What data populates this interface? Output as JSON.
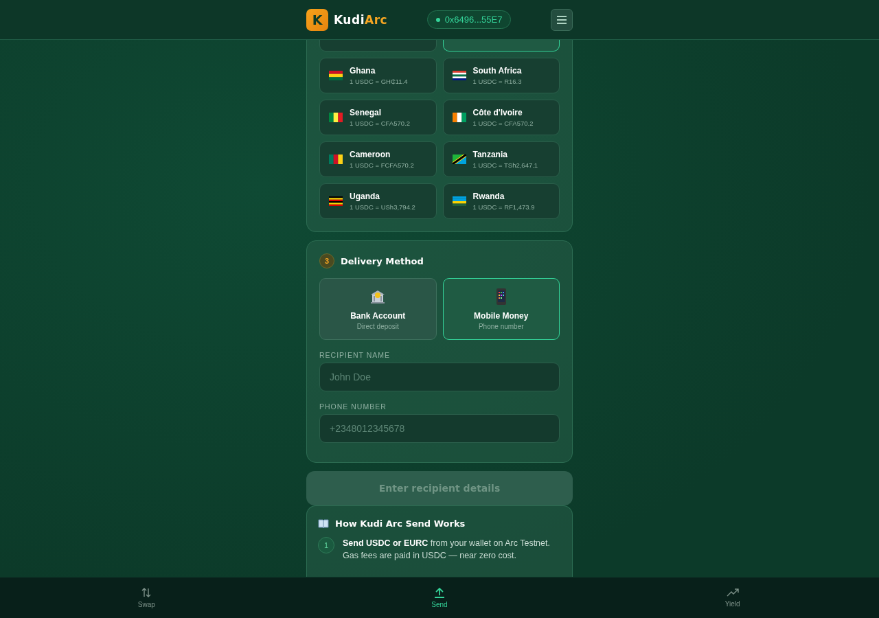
{
  "header": {
    "logo_letter": "K",
    "brand": "Kudi",
    "brand_accent": "Arc",
    "wallet": "0x6496...55E7"
  },
  "countries": [
    {
      "kind": "partial",
      "selected": false
    },
    {
      "kind": "partial",
      "selected": true
    },
    {
      "kind": "full",
      "name": "Ghana",
      "rate": "1 USDC = GH₵11.4",
      "selected": false
    },
    {
      "kind": "full",
      "name": "South Africa",
      "rate": "1 USDC = R16.3",
      "selected": false
    },
    {
      "kind": "full",
      "name": "Senegal",
      "rate": "1 USDC = CFA570.2",
      "selected": false
    },
    {
      "kind": "full",
      "name": "Côte d'Ivoire",
      "rate": "1 USDC = CFA570.2",
      "selected": false
    },
    {
      "kind": "full",
      "name": "Cameroon",
      "rate": "1 USDC = FCFA570.2",
      "selected": false
    },
    {
      "kind": "full",
      "name": "Tanzania",
      "rate": "1 USDC = TSh2,647.1",
      "selected": false
    },
    {
      "kind": "full",
      "name": "Uganda",
      "rate": "1 USDC = USh3,794.2",
      "selected": false
    },
    {
      "kind": "full",
      "name": "Rwanda",
      "rate": "1 USDC = RF1,473.9",
      "selected": false
    }
  ],
  "delivery": {
    "step": "3",
    "title": "Delivery Method",
    "methods": [
      {
        "kind": "bank",
        "label": "Bank Account",
        "sub": "Direct deposit",
        "selected": false
      },
      {
        "kind": "phone",
        "label": "Mobile Money",
        "sub": "Phone number",
        "selected": true
      }
    ],
    "fields": [
      {
        "label": "RECIPIENT NAME",
        "placeholder": "John Doe"
      },
      {
        "label": "PHONE NUMBER",
        "placeholder": "+2348012345678"
      }
    ]
  },
  "submit": {
    "label": "Enter recipient details",
    "disabled": true
  },
  "how": {
    "title": "How Kudi Arc Send Works",
    "steps": [
      {
        "number": "1",
        "text": "**Send USDC or EURC** from your wallet on Arc Testnet. Gas fees are paid in USDC — near zero cost."
      }
    ]
  },
  "nav": [
    {
      "kind": "swap",
      "label": "Swap",
      "selected": false
    },
    {
      "kind": "send",
      "label": "Send",
      "selected": true
    },
    {
      "kind": "yield",
      "label": "Yield",
      "selected": false
    }
  ]
}
